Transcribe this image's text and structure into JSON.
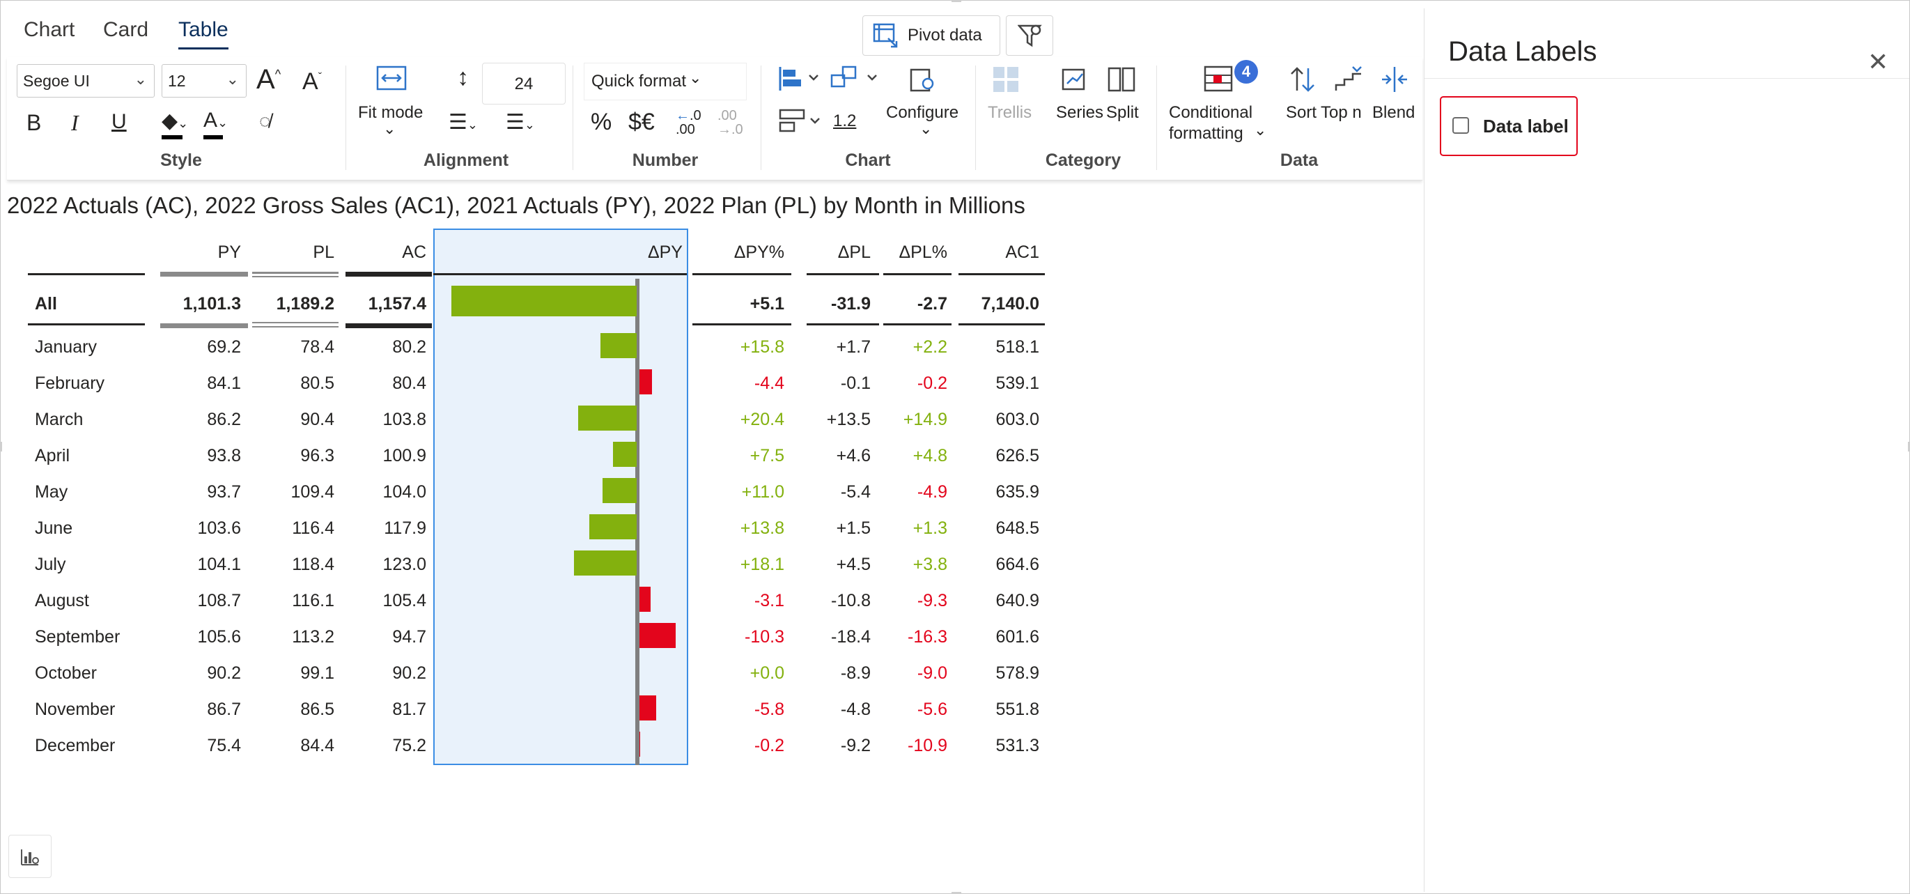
{
  "tabs": [
    {
      "label": "Chart",
      "active": false
    },
    {
      "label": "Card",
      "active": false
    },
    {
      "label": "Table",
      "active": true
    }
  ],
  "top_buttons": {
    "pivot": "Pivot  data"
  },
  "ribbon": {
    "style": {
      "font": "Segoe UI",
      "size": "12",
      "group": "Style"
    },
    "alignment": {
      "fit_mode": "Fit mode",
      "row_height": "24",
      "group": "Alignment"
    },
    "number": {
      "quick_format": "Quick format",
      "percent": "%",
      "currency": "$€",
      "group": "Number"
    },
    "chart": {
      "value": "1.2",
      "configure": "Configure",
      "group": "Chart"
    },
    "category": {
      "trellis": "Trellis",
      "series": "Series",
      "split": "Split",
      "group": "Category"
    },
    "data": {
      "conditional_formatting": "Conditional",
      "conditional_formatting_2": "formatting",
      "cf_count": "4",
      "sort": "Sort",
      "top_n": "Top n",
      "blend": "Blend",
      "group": "Data"
    }
  },
  "title": "2022 Actuals (AC), 2022 Gross Sales (AC1), 2021 Actuals (PY), 2022 Plan (PL) by Month in Millions",
  "table": {
    "headers": [
      "PY",
      "PL",
      "AC",
      "ΔPY",
      "ΔPY%",
      "ΔPL",
      "ΔPL%",
      "AC1"
    ],
    "total": {
      "label": "All",
      "PY": "1,101.3",
      "PL": "1,189.2",
      "AC": "1,157.4",
      "dPY": 56.1,
      "dPYpct": "+5.1",
      "dPL": "-31.9",
      "dPLpct": "-2.7",
      "AC1": "7,140.0"
    },
    "rows": [
      {
        "label": "January",
        "PY": "69.2",
        "PL": "78.4",
        "AC": "80.2",
        "dPY": 11.0,
        "dPYpct": "+15.8",
        "dPL": "+1.7",
        "dPLpct": "+2.2",
        "AC1": "518.1"
      },
      {
        "label": "February",
        "PY": "84.1",
        "PL": "80.5",
        "AC": "80.4",
        "dPY": -3.7,
        "dPYpct": "-4.4",
        "dPL": "-0.1",
        "dPLpct": "-0.2",
        "AC1": "539.1"
      },
      {
        "label": "March",
        "PY": "86.2",
        "PL": "90.4",
        "AC": "103.8",
        "dPY": 17.6,
        "dPYpct": "+20.4",
        "dPL": "+13.5",
        "dPLpct": "+14.9",
        "AC1": "603.0"
      },
      {
        "label": "April",
        "PY": "93.8",
        "PL": "96.3",
        "AC": "100.9",
        "dPY": 7.1,
        "dPYpct": "+7.5",
        "dPL": "+4.6",
        "dPLpct": "+4.8",
        "AC1": "626.5"
      },
      {
        "label": "May",
        "PY": "93.7",
        "PL": "109.4",
        "AC": "104.0",
        "dPY": 10.3,
        "dPYpct": "+11.0",
        "dPL": "-5.4",
        "dPLpct": "-4.9",
        "AC1": "635.9"
      },
      {
        "label": "June",
        "PY": "103.6",
        "PL": "116.4",
        "AC": "117.9",
        "dPY": 14.3,
        "dPYpct": "+13.8",
        "dPL": "+1.5",
        "dPLpct": "+1.3",
        "AC1": "648.5"
      },
      {
        "label": "July",
        "PY": "104.1",
        "PL": "118.4",
        "AC": "123.0",
        "dPY": 18.9,
        "dPYpct": "+18.1",
        "dPL": "+4.5",
        "dPLpct": "+3.8",
        "AC1": "664.6"
      },
      {
        "label": "August",
        "PY": "108.7",
        "PL": "116.1",
        "AC": "105.4",
        "dPY": -3.3,
        "dPYpct": "-3.1",
        "dPL": "-10.8",
        "dPLpct": "-9.3",
        "AC1": "640.9"
      },
      {
        "label": "September",
        "PY": "105.6",
        "PL": "113.2",
        "AC": "94.7",
        "dPY": -10.9,
        "dPYpct": "-10.3",
        "dPL": "-18.4",
        "dPLpct": "-16.3",
        "AC1": "601.6"
      },
      {
        "label": "October",
        "PY": "90.2",
        "PL": "99.1",
        "AC": "90.2",
        "dPY": 0.0,
        "dPYpct": "+0.0",
        "dPL": "-8.9",
        "dPLpct": "-9.0",
        "AC1": "578.9"
      },
      {
        "label": "November",
        "PY": "86.7",
        "PL": "86.5",
        "AC": "81.7",
        "dPY": -5.0,
        "dPYpct": "-5.8",
        "dPL": "-4.8",
        "dPLpct": "-5.6",
        "AC1": "551.8"
      },
      {
        "label": "December",
        "PY": "75.4",
        "PL": "84.4",
        "AC": "75.2",
        "dPY": -0.2,
        "dPYpct": "-0.2",
        "dPL": "-9.2",
        "dPLpct": "-10.9",
        "AC1": "531.3"
      }
    ]
  },
  "colors": {
    "positive": "#83b10e",
    "negative": "#e3051c",
    "selection": "#3b8de4",
    "accent": "#0b2f5c"
  },
  "panel": {
    "title": "Data Labels",
    "checkbox_label": "Data label",
    "checked": false
  }
}
